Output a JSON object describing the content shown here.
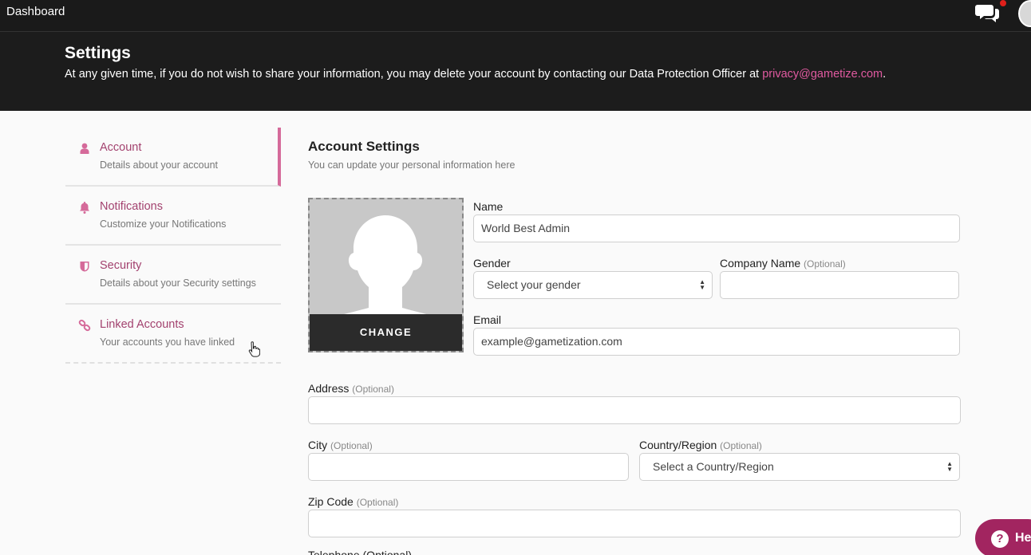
{
  "topbar": {
    "brand": "Dashboard",
    "chat_icon": "chat-bubbles-icon",
    "notification_color": "#e0201b"
  },
  "header": {
    "title": "Settings",
    "desc_prefix": "At any given time, if you do not wish to share your information, you may delete your account by contacting our Data Protection Officer at ",
    "email_link": "privacy@gametize.com",
    "desc_suffix": "."
  },
  "sidebar": {
    "items": [
      {
        "label": "Account",
        "sub": "Details about your account",
        "icon": "user-icon",
        "active": true
      },
      {
        "label": "Notifications",
        "sub": "Customize your Notifications",
        "icon": "bell-icon"
      },
      {
        "label": "Security",
        "sub": "Details about your Security settings",
        "icon": "shield-icon"
      },
      {
        "label": "Linked Accounts",
        "sub": "Your accounts you have linked",
        "icon": "link-icon"
      }
    ]
  },
  "main": {
    "title": "Account Settings",
    "subtitle": "You can update your personal information here",
    "photo_change_label": "CHANGE",
    "optional": "(Optional)",
    "fields": {
      "name_label": "Name",
      "name_value": "World Best Admin",
      "gender_label": "Gender",
      "gender_value": "Select your gender",
      "company_label": "Company Name",
      "email_label": "Email",
      "email_value": "example@gametization.com",
      "address_label": "Address",
      "city_label": "City",
      "country_label": "Country/Region",
      "country_value": "Select a Country/Region",
      "zip_label": "Zip Code",
      "next_label_partial": "Telephone"
    }
  },
  "help": {
    "label": "He"
  },
  "colors": {
    "accent": "#a3426f",
    "active_bar": "#d56a9a",
    "help_bg": "#a22560",
    "link": "#e05aa0"
  }
}
